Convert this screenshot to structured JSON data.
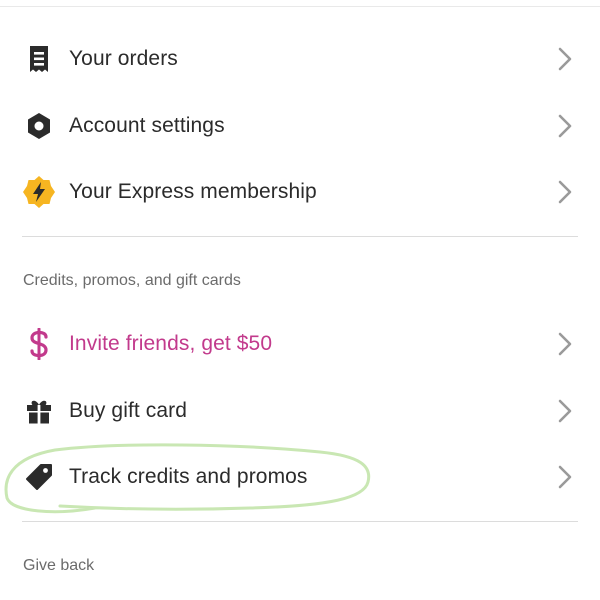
{
  "menu_top": [
    {
      "label": "Your orders",
      "icon": "receipt-icon"
    },
    {
      "label": "Account settings",
      "icon": "gear-icon"
    },
    {
      "label": "Your Express membership",
      "icon": "lightning-badge-icon"
    }
  ],
  "credits_section": {
    "heading": "Credits, promos, and gift cards",
    "items": [
      {
        "label": "Invite friends, get $50",
        "icon": "dollar-icon",
        "color": "#c23a8c"
      },
      {
        "label": "Buy gift card",
        "icon": "gift-icon"
      },
      {
        "label": "Track credits and promos",
        "icon": "tag-icon"
      }
    ]
  },
  "give_back_section": {
    "heading": "Give back"
  },
  "colors": {
    "accent_pink": "#c23a8c",
    "express_badge": "#f6b521",
    "highlight_annotation": "#c9e7b3"
  }
}
